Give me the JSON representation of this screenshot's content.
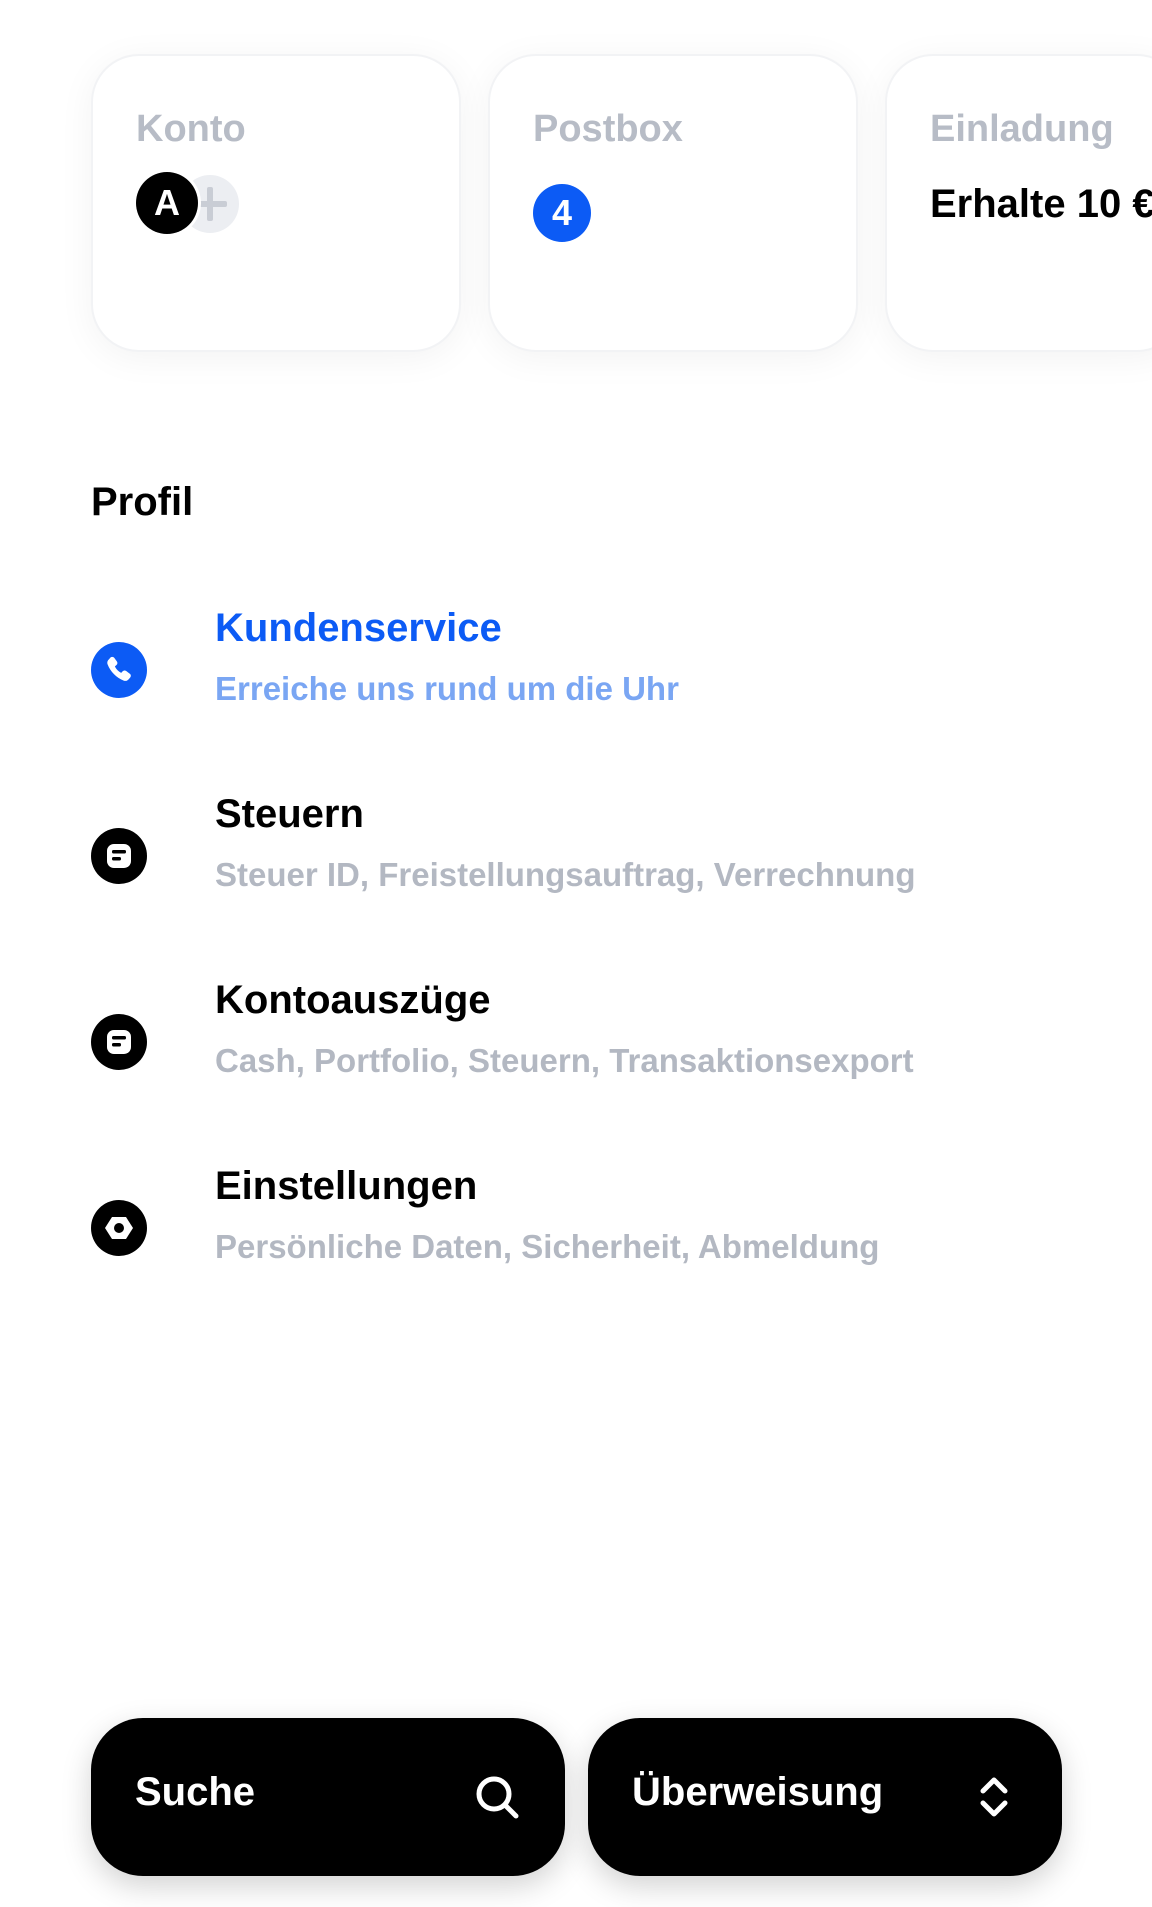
{
  "cards": {
    "konto": {
      "title": "Konto",
      "avatar_initial": "A"
    },
    "postbox": {
      "title": "Postbox",
      "unread_count": "4"
    },
    "einladung": {
      "title": "Einladung",
      "text": "Erhalte 10 €"
    }
  },
  "profile": {
    "section_title": "Profil",
    "items": [
      {
        "label": "Kundenservice",
        "subtitle": "Erreiche uns rund um die Uhr",
        "icon": "phone-icon",
        "highlighted": true
      },
      {
        "label": "Steuern",
        "subtitle": "Steuer ID, Freistellungsauftrag, Verrechnung",
        "icon": "document-icon"
      },
      {
        "label": "Kontoauszüge",
        "subtitle": "Cash, Portfolio, Steuern, Transaktionsexport",
        "icon": "document-icon"
      },
      {
        "label": "Einstellungen",
        "subtitle": "Persönliche Daten, Sicherheit, Abmeldung",
        "icon": "gear-icon"
      }
    ]
  },
  "bottom_bar": {
    "search_label": "Suche",
    "search_icon": "search-icon",
    "transfer_label": "Überweisung",
    "transfer_icon": "chevron-up-down-icon"
  },
  "colors": {
    "accent": "#0c5bf5",
    "accent_light": "#7aa6f3",
    "muted_text": "#b3b8c2",
    "card_title": "#b7bcc6",
    "button_bg": "#000000"
  }
}
